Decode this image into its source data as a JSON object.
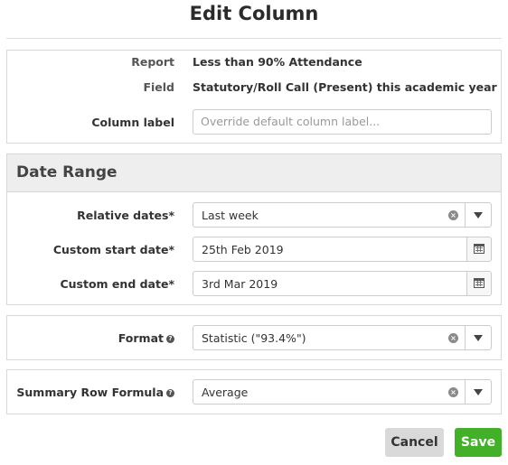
{
  "dialog": {
    "title": "Edit Column"
  },
  "info": {
    "report_label": "Report",
    "report_value": "Less than 90% Attendance",
    "field_label": "Field",
    "field_value": "Statutory/Roll Call (Present) this academic year",
    "column_label": "Column label",
    "column_placeholder": "Override default column label..."
  },
  "date_range": {
    "header": "Date Range",
    "relative_label": "Relative dates*",
    "relative_value": "Last week",
    "start_label": "Custom start date*",
    "start_value": "25th Feb 2019",
    "end_label": "Custom end date*",
    "end_value": "3rd Mar 2019"
  },
  "format": {
    "label": "Format",
    "value": "Statistic (\"93.4%\")"
  },
  "summary": {
    "label": "Summary Row Formula",
    "value": "Average"
  },
  "actions": {
    "cancel": "Cancel",
    "save": "Save"
  },
  "icons": {
    "help": "question-circle-icon",
    "clear": "times-circle-icon",
    "caret": "caret-down-icon",
    "calendar": "calendar-icon"
  },
  "colors": {
    "save": "#43b02a",
    "cancel": "#d9d9d9",
    "header_bg": "#eeeeee"
  }
}
